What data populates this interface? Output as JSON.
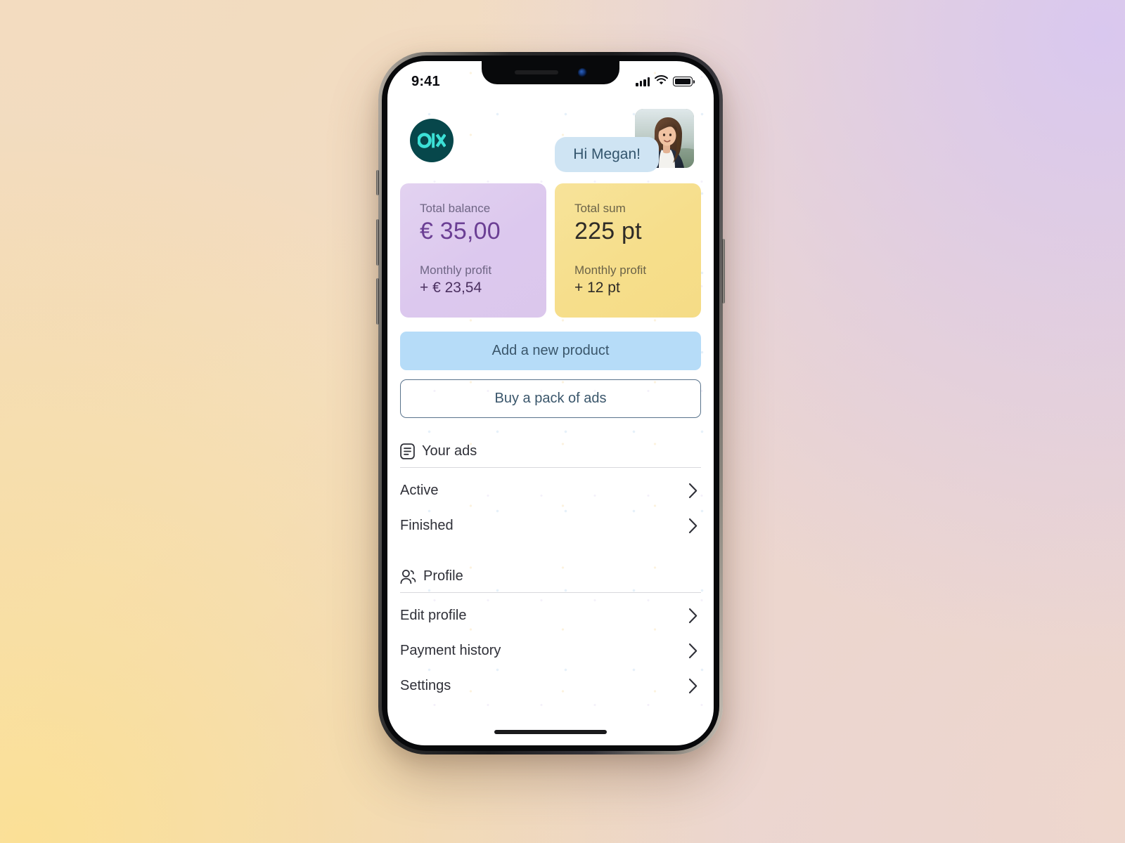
{
  "background": {
    "top_left": "#f3dcc0",
    "top_right": "#d9c8ef",
    "bottom_left": "#fbe096",
    "bottom_right": "#eed7cd"
  },
  "status_bar": {
    "time": "9:41",
    "cellular_icon": "cellular-signal-icon",
    "wifi_icon": "wifi-icon",
    "battery_icon": "battery-full-icon"
  },
  "header": {
    "logo": {
      "name": "olx-logo",
      "text": "o|x",
      "circle_color": "#07474b",
      "mark_color": "#3ce0d6"
    },
    "greeting": "Hi Megan!",
    "greeting_bubble_color": "#cfe4f3",
    "avatar_alt": "Megan profile photo"
  },
  "cards": [
    {
      "id": "total-balance",
      "label": "Total balance",
      "value": "€ 35,00",
      "sub_label": "Monthly profit",
      "sub_value": "+ € 23,54",
      "color": "#dcc8ee"
    },
    {
      "id": "total-sum",
      "label": "Total sum",
      "value": "225 pt",
      "sub_label": "Monthly profit",
      "sub_value": "+ 12 pt",
      "color": "#f6de8b"
    }
  ],
  "actions": {
    "primary_label": "Add a new product",
    "primary_color": "#b6dcf8",
    "outline_label": "Buy a pack of ads",
    "outline_border_color": "#59738c"
  },
  "sections": [
    {
      "id": "your-ads",
      "title": "Your ads",
      "icon": "document-list-icon",
      "rows": [
        {
          "id": "active",
          "label": "Active",
          "chevron": "chevron-right-icon"
        },
        {
          "id": "finished",
          "label": "Finished",
          "chevron": "chevron-right-icon"
        }
      ]
    },
    {
      "id": "profile",
      "title": "Profile",
      "icon": "people-icon",
      "rows": [
        {
          "id": "edit-profile",
          "label": "Edit profile",
          "chevron": "chevron-right-icon"
        },
        {
          "id": "payment-history",
          "label": "Payment history",
          "chevron": "chevron-right-icon"
        },
        {
          "id": "settings",
          "label": "Settings",
          "chevron": "chevron-right-icon"
        }
      ]
    }
  ],
  "home_indicator": "home-indicator-bar"
}
